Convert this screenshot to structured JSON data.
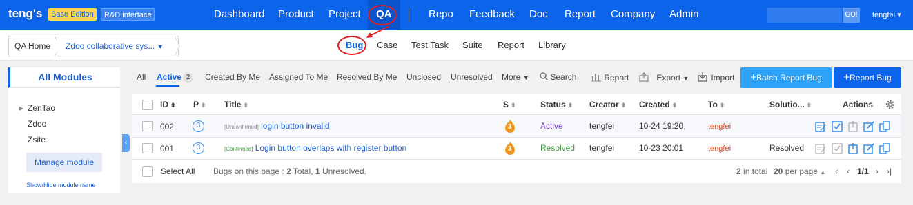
{
  "topbar": {
    "brand": "teng's",
    "edition": "Base Edition",
    "interface": "R&D interface",
    "nav": [
      "Dashboard",
      "Product",
      "Project",
      "QA",
      "Repo",
      "Feedback",
      "Doc",
      "Report",
      "Company",
      "Admin"
    ],
    "active_nav": "QA",
    "search_placeholder": "",
    "search_go": "GO!",
    "user": "tengfei"
  },
  "subbar": {
    "home": "QA Home",
    "product": "Zdoo collaborative sys...",
    "tabs": [
      "Bug",
      "Case",
      "Test Task",
      "Suite",
      "Report",
      "Library"
    ],
    "active_tab": "Bug"
  },
  "sidebar": {
    "title": "All Modules",
    "modules": [
      "ZenTao",
      "Zdoo",
      "Zsite"
    ],
    "manage_label": "Manage module",
    "toggle_label": "Show/Hide module name"
  },
  "filters": {
    "all": "All",
    "active": "Active",
    "active_count": "2",
    "created_by_me": "Created By Me",
    "assigned_to_me": "Assigned To Me",
    "resolved_by_me": "Resolved By Me",
    "unclosed": "Unclosed",
    "unresolved": "Unresolved",
    "more": "More",
    "search": "Search",
    "report": "Report",
    "export": "Export",
    "import": "Import",
    "batch_report": "Batch Report Bug",
    "report_bug": "Report Bug"
  },
  "table": {
    "headers": {
      "id": "ID",
      "pri": "P",
      "title": "Title",
      "severity": "S",
      "status": "Status",
      "creator": "Creator",
      "created": "Created",
      "to": "To",
      "solution": "Solutio...",
      "actions": "Actions"
    },
    "rows": [
      {
        "id": "002",
        "pri": "3",
        "tag": "[Unconfirmed]",
        "title": "login button invalid",
        "severity": "3",
        "status": "Active",
        "creator": "tengfei",
        "created": "10-24 19:20",
        "to": "tengfei",
        "solution": ""
      },
      {
        "id": "001",
        "pri": "3",
        "tag": "[Confirmed]",
        "title": "Login button overlaps with register button",
        "severity": "3",
        "status": "Resolved",
        "creator": "tengfei",
        "created": "10-23 20:01",
        "to": "tengfei",
        "solution": "Resolved"
      }
    ],
    "footer": {
      "select_all": "Select All",
      "summary_prefix": "Bugs on this page :",
      "total_count": "2",
      "total_label": "Total,",
      "unresolved_count": "1",
      "unresolved_label": "Unresolved.",
      "in_total_count": "2",
      "in_total_label": "in total",
      "per_page": "20",
      "per_page_label": "per page",
      "page": "1/1"
    }
  },
  "colors": {
    "primary": "#0c64eb",
    "accent_light": "#2ea2f7",
    "annotation": "#e02020"
  }
}
